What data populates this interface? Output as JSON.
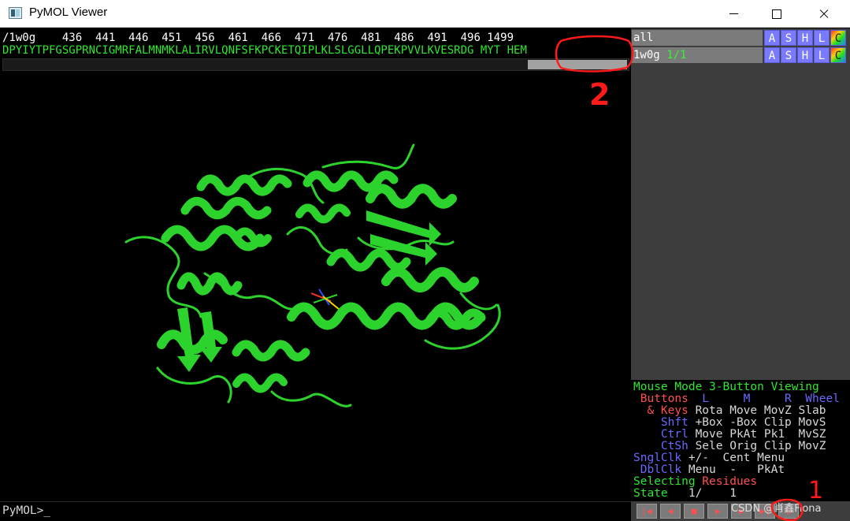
{
  "window": {
    "title": "PyMOL Viewer",
    "controls": [
      "minimize",
      "maximize",
      "close"
    ]
  },
  "sequence": {
    "header": "/1w0g    436  441  446  451  456  461  466  471  476  481  486  491  496 1499",
    "residues": "DPYIYTPFGSGPRNCIGMRFALMNMKLALIRVLQNFSFKPCKETQIPLKLSLGGLLQPEKPVVLKVESRDG MYT HEM"
  },
  "objects": [
    {
      "name": "all",
      "state": "",
      "buttons": [
        "A",
        "S",
        "H",
        "L",
        "C"
      ]
    },
    {
      "name": "1w0g",
      "state": "1/1",
      "buttons": [
        "A",
        "S",
        "H",
        "L",
        "C"
      ]
    }
  ],
  "mouse_mode": {
    "line1": "Mouse Mode 3-Button Viewing",
    "buttons_label": " Buttons",
    "buttons_cols": "  L     M     R  Wheel",
    "keys_label": "  & Keys",
    "keys_vals": " Rota Move MovZ Slab",
    "shft_label": "    Shft",
    "shft_vals": " +Box -Box Clip MovS",
    "ctrl_label": "    Ctrl",
    "ctrl_vals": " Move PkAt Pk1  MvSZ",
    "ctsh_label": "    CtSh",
    "ctsh_vals": " Sele Orig Clip MovZ",
    "snglclk_label": "SnglClk",
    "snglclk_vals": " +/-  Cent Menu",
    "dblclk_label": " DblClk",
    "dblclk_vals": " Menu  -   PkAt",
    "selecting_label": "Selecting",
    "selecting_value": " Residues",
    "state_label": "State",
    "state_value": "   1/    1"
  },
  "command": {
    "prompt": "PyMOL>_"
  },
  "movie_controls": [
    "rewind-icon",
    "step-back-icon",
    "stop-icon",
    "play-icon",
    "step-forward-icon",
    "fast-forward-icon",
    "loop-icon"
  ],
  "watermark": "CSDN @肖鑫Fiona",
  "annotations": {
    "label_2": "2",
    "label_1": "1"
  },
  "colors": {
    "sequence": "#2ee62e",
    "protein": "#2dd32d",
    "panel_bg": "#3d3d3d",
    "object_name_bg": "#7b7b7b",
    "button_bg": "#7a7aff",
    "annotation_red": "#ff1a1a"
  }
}
